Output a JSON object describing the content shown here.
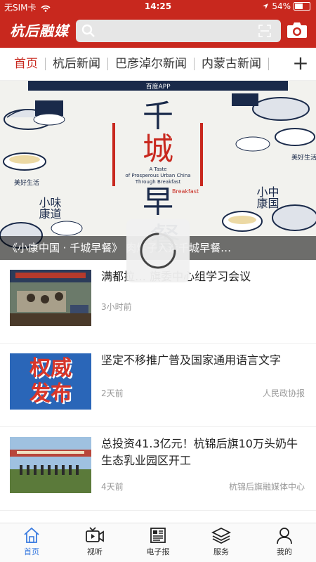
{
  "status": {
    "carrier": "无SIM卡",
    "time": "14:25",
    "battery": "54%",
    "battery_level": 0.54
  },
  "header": {
    "logo": "杭后融媒",
    "search_placeholder": ""
  },
  "tabs": [
    {
      "label": "首页",
      "active": true
    },
    {
      "label": "杭后新闻"
    },
    {
      "label": "巴彦淖尔新闻"
    },
    {
      "label": "内蒙古新闻"
    }
  ],
  "banner": {
    "caption": "《小康中国 · 千城早餐》 肉炸子入选千城早餐…",
    "poster": {
      "title_chars": [
        "千",
        "城",
        "早",
        "餐"
      ],
      "subtitle_en": "A Taste of Prosperous Urban China Through Breakfast",
      "tag": "Breakfast",
      "side_left": "小康味道",
      "side_right": "小康中国",
      "slogan_left": "美好生活",
      "slogan_right": "美好生活",
      "partners": "百度APP"
    }
  },
  "news": [
    {
      "title": "满都拉… 旗委中心组学习会议",
      "time": "3小时前",
      "source": ""
    },
    {
      "title": "坚定不移推广普及国家通用语言文字",
      "time": "2天前",
      "source": "人民政协报",
      "thumb_text": [
        "权威",
        "发布"
      ]
    },
    {
      "title": "总投资41.3亿元！杭锦后旗10万头奶牛生态乳业园区开工",
      "time": "4天前",
      "source": "杭锦后旗融媒体中心"
    }
  ],
  "nav": [
    {
      "label": "首页",
      "icon": "home-icon",
      "active": true
    },
    {
      "label": "视听",
      "icon": "video-icon"
    },
    {
      "label": "电子报",
      "icon": "newspaper-icon"
    },
    {
      "label": "服务",
      "icon": "layers-icon"
    },
    {
      "label": "我的",
      "icon": "user-icon"
    }
  ],
  "colors": {
    "brand": "#c8281e",
    "active_nav": "#3a7be0"
  }
}
